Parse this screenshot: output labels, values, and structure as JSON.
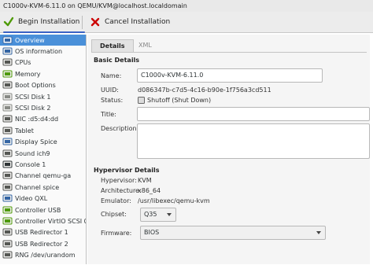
{
  "window": {
    "title": "C1000v-KVM-6.11.0 on QEMU/KVM@localhost.localdomain"
  },
  "toolbar": {
    "begin_label": "Begin Installation",
    "cancel_label": "Cancel Installation"
  },
  "sidebar": {
    "items": [
      {
        "label": "Overview",
        "icon": "monitor-icon"
      },
      {
        "label": "OS information",
        "icon": "info-icon"
      },
      {
        "label": "CPUs",
        "icon": "cpu-icon"
      },
      {
        "label": "Memory",
        "icon": "memory-icon"
      },
      {
        "label": "Boot Options",
        "icon": "boot-icon"
      },
      {
        "label": "SCSI Disk 1",
        "icon": "disk-icon"
      },
      {
        "label": "SCSI Disk 2",
        "icon": "disk-icon"
      },
      {
        "label": "NIC :d5:d4:dd",
        "icon": "nic-icon"
      },
      {
        "label": "Tablet",
        "icon": "tablet-icon"
      },
      {
        "label": "Display Spice",
        "icon": "display-icon"
      },
      {
        "label": "Sound ich9",
        "icon": "sound-icon"
      },
      {
        "label": "Console 1",
        "icon": "console-icon"
      },
      {
        "label": "Channel qemu-ga",
        "icon": "channel-icon"
      },
      {
        "label": "Channel spice",
        "icon": "channel-icon"
      },
      {
        "label": "Video QXL",
        "icon": "video-icon"
      },
      {
        "label": "Controller USB",
        "icon": "controller-icon"
      },
      {
        "label": "Controller VirtIO SCSI 0",
        "icon": "controller-icon"
      },
      {
        "label": "USB Redirector 1",
        "icon": "usb-icon"
      },
      {
        "label": "USB Redirector 2",
        "icon": "usb-icon"
      },
      {
        "label": "RNG /dev/urandom",
        "icon": "rng-icon"
      }
    ]
  },
  "tabs": {
    "details": "Details",
    "xml": "XML"
  },
  "basic": {
    "title": "Basic Details",
    "name_label": "Name:",
    "name_value": "C1000v-KVM-6.11.0",
    "uuid_label": "UUID:",
    "uuid_value": "d086347b-c7d5-4c16-b90e-1f756a3cd511",
    "status_label": "Status:",
    "status_value": "Shutoff (Shut Down)",
    "title_label": "Title:",
    "title_value": "",
    "desc_label": "Description:",
    "desc_value": ""
  },
  "hypervisor": {
    "title": "Hypervisor Details",
    "hv_label": "Hypervisor:",
    "hv_value": "KVM",
    "arch_label": "Architecture:",
    "arch_value": "x86_64",
    "emu_label": "Emulator:",
    "emu_value": "/usr/libexec/qemu-kvm",
    "chipset_label": "Chipset:",
    "chipset_value": "Q35",
    "firmware_label": "Firmware:",
    "firmware_value": "BIOS"
  }
}
